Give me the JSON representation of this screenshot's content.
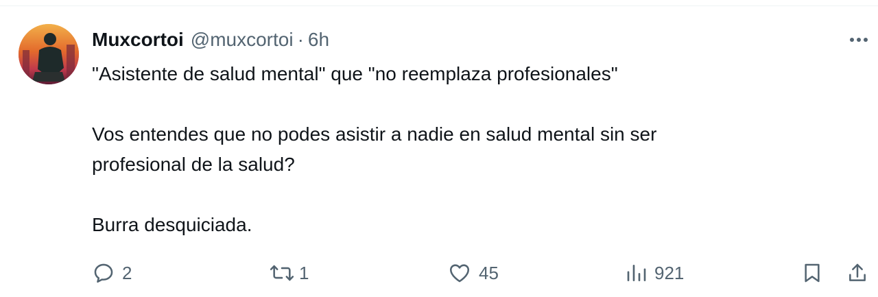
{
  "tweet": {
    "author_name": "Muxcortoi",
    "handle": "@muxcortoi",
    "separator": "·",
    "time": "6h",
    "text_lines": [
      "\"Asistente de salud mental\" que \"no reemplaza profesionales\"",
      "",
      "Vos entendes que no podes asistir a nadie en salud mental sin ser",
      "profesional de la salud?",
      "",
      "Burra desquiciada."
    ]
  },
  "actions": {
    "reply_count": "2",
    "retweet_count": "1",
    "like_count": "45",
    "views_count": "921"
  },
  "icons": {
    "reply": "reply-icon",
    "retweet": "retweet-icon",
    "like": "heart-icon",
    "views": "views-chart-icon",
    "bookmark": "bookmark-icon",
    "share": "share-icon",
    "more": "more-dots-icon"
  },
  "colors": {
    "text": "#0f1419",
    "secondary": "#536471",
    "divider": "#eff3f4"
  }
}
